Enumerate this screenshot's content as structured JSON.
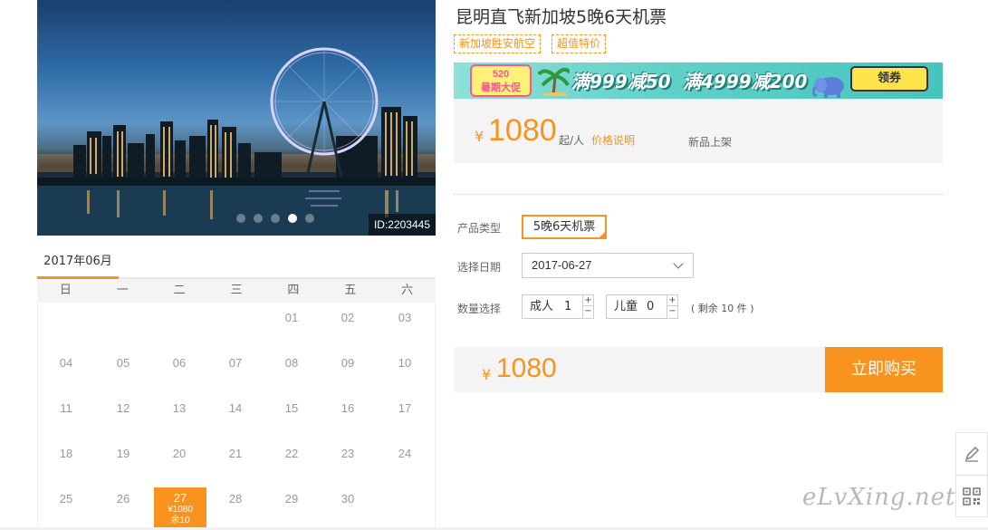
{
  "hero": {
    "image_id": "ID:2203445",
    "slide_count": 5,
    "active_slide": 4
  },
  "calendar": {
    "month_label": "2017年06月",
    "weekdays": [
      "日",
      "一",
      "二",
      "三",
      "四",
      "五",
      "六"
    ],
    "weeks": [
      [
        "",
        "",
        "",
        "",
        "01",
        "02",
        "03"
      ],
      [
        "04",
        "05",
        "06",
        "07",
        "08",
        "09",
        "10"
      ],
      [
        "11",
        "12",
        "13",
        "14",
        "15",
        "16",
        "17"
      ],
      [
        "18",
        "19",
        "20",
        "21",
        "22",
        "23",
        "24"
      ],
      [
        "25",
        "26",
        "27",
        "28",
        "29",
        "30",
        ""
      ]
    ],
    "selected": {
      "day": "27",
      "price": "¥1080",
      "stock": "余10"
    }
  },
  "product": {
    "title": "昆明直飞新加坡5晚6天机票",
    "tags": [
      "新加坡胜安航空",
      "超值特价"
    ],
    "currency": "¥",
    "price": "1080",
    "per_person": "起/人",
    "price_note_link": "价格说明",
    "new_label": "新品上架"
  },
  "banner": {
    "badge_line1": "520",
    "badge_line2": "暑期大促",
    "promo1": "满999减50",
    "promo2": "满4999减200",
    "button": "领券"
  },
  "form": {
    "type_label": "产品类型",
    "type_value": "5晚6天机票",
    "date_label": "选择日期",
    "date_value": "2017-06-27",
    "qty_label": "数量选择",
    "adult_label": "成人",
    "adult_value": "1",
    "child_label": "儿童",
    "child_value": "0",
    "plus": "+",
    "minus": "−",
    "stock_note": "( 剩余 10 件 )"
  },
  "total": {
    "currency": "¥",
    "price": "1080",
    "buy_button": "立即购买"
  },
  "side": {
    "watermark": "eLvXing.net",
    "icons": [
      "edit-icon",
      "qrcode-icon"
    ]
  },
  "colors": {
    "accent": "#f7931e",
    "panel": "#f4f4f4"
  }
}
